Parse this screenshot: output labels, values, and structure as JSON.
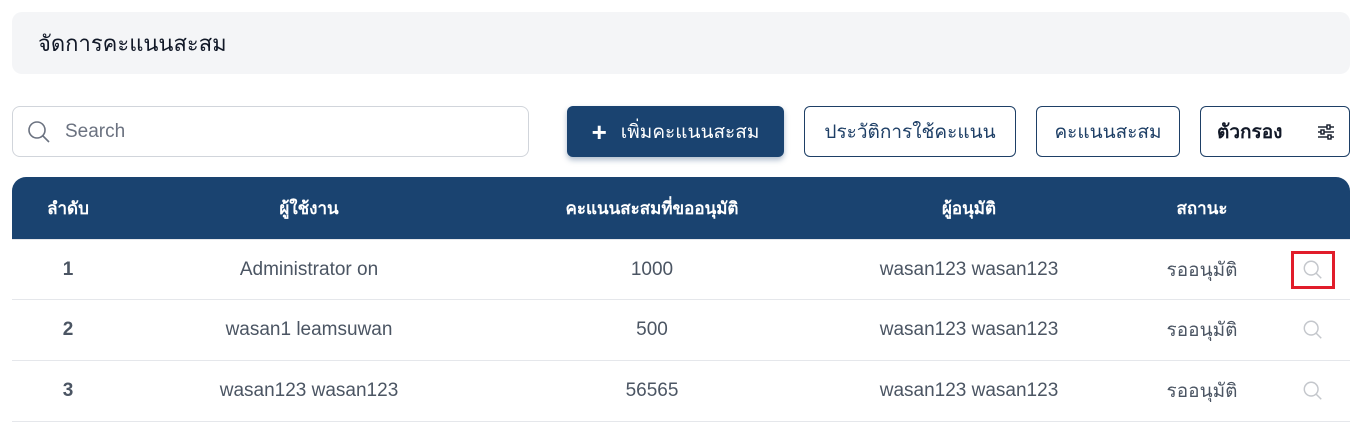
{
  "page": {
    "title": "จัดการคะแนนสะสม"
  },
  "toolbar": {
    "search_placeholder": "Search",
    "add_label": "เพิ่มคะแนนสะสม",
    "add_icon": "plus-icon",
    "history_label": "ประวัติการใช้คะแนน",
    "points_label": "คะแนนสะสม",
    "filter_label": "ตัวกรอง",
    "filter_icon": "sliders-icon"
  },
  "table": {
    "headers": {
      "index": "ลำดับ",
      "user": "ผู้ใช้งาน",
      "points": "คะแนนสะสมที่ขออนุมัติ",
      "approver": "ผู้อนุมัติ",
      "status": "สถานะ"
    },
    "rows": [
      {
        "index": "1",
        "user": "Administrator on",
        "points": "1000",
        "approver": "wasan123 wasan123",
        "status": "รออนุมัติ"
      },
      {
        "index": "2",
        "user": "wasan1 leamsuwan",
        "points": "500",
        "approver": "wasan123 wasan123",
        "status": "รออนุมัติ"
      },
      {
        "index": "3",
        "user": "wasan123 wasan123",
        "points": "56565",
        "approver": "wasan123 wasan123",
        "status": "รออนุมัติ"
      }
    ]
  },
  "colors": {
    "primary": "#1a4370",
    "highlight": "#e11d2a"
  }
}
